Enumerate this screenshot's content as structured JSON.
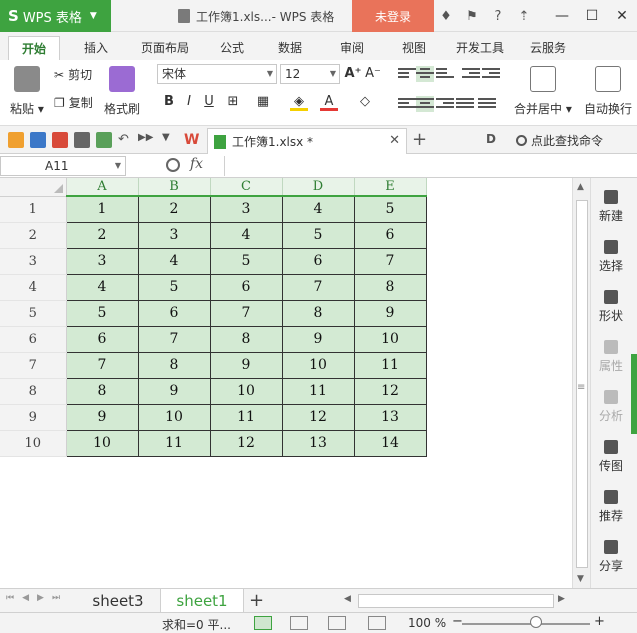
{
  "app": {
    "name": "WPS 表格",
    "doc_title": "工作簿1.xls...- WPS 表格",
    "login_label": "未登录"
  },
  "menu": {
    "tabs": [
      "开始",
      "插入",
      "页面布局",
      "公式",
      "数据",
      "审阅",
      "视图",
      "开发工具",
      "云服务"
    ],
    "active_index": 0
  },
  "ribbon": {
    "paste": "粘贴",
    "cut": "剪切",
    "copy": "复制",
    "format_painter": "格式刷",
    "font_name": "宋体",
    "font_size": "12",
    "bold": "B",
    "italic": "I",
    "underline": "U",
    "merge_center": "合并居中",
    "auto_wrap": "自动换行"
  },
  "doc_tab": {
    "label": "工作簿1.xlsx *",
    "search_cmd": "点此查找命令"
  },
  "formula_bar": {
    "name_box": "A11",
    "fx": "fx",
    "content": ""
  },
  "sheet": {
    "columns": [
      "A",
      "B",
      "C",
      "D",
      "E"
    ],
    "rows": [
      {
        "header": "1",
        "cells": [
          "1",
          "2",
          "3",
          "4",
          "5"
        ]
      },
      {
        "header": "2",
        "cells": [
          "2",
          "3",
          "4",
          "5",
          "6"
        ]
      },
      {
        "header": "3",
        "cells": [
          "3",
          "4",
          "5",
          "6",
          "7"
        ]
      },
      {
        "header": "4",
        "cells": [
          "4",
          "5",
          "6",
          "7",
          "8"
        ]
      },
      {
        "header": "5",
        "cells": [
          "5",
          "6",
          "7",
          "8",
          "9"
        ]
      },
      {
        "header": "6",
        "cells": [
          "6",
          "7",
          "8",
          "9",
          "10"
        ]
      },
      {
        "header": "7",
        "cells": [
          "7",
          "8",
          "9",
          "10",
          "11"
        ]
      },
      {
        "header": "8",
        "cells": [
          "8",
          "9",
          "10",
          "11",
          "12"
        ]
      },
      {
        "header": "9",
        "cells": [
          "9",
          "10",
          "11",
          "12",
          "13"
        ]
      },
      {
        "header": "10",
        "cells": [
          "10",
          "11",
          "12",
          "13",
          "14"
        ]
      }
    ]
  },
  "side_panel": {
    "items": [
      "新建",
      "选择",
      "形状",
      "属性",
      "分析",
      "传图",
      "推荐",
      "分享"
    ],
    "disabled": [
      false,
      false,
      false,
      true,
      true,
      false,
      false,
      false
    ]
  },
  "sheet_tabs": {
    "tabs": [
      "sheet3",
      "sheet1"
    ],
    "active_index": 1
  },
  "status_bar": {
    "summary": "求和=0  平...",
    "zoom": "100 %"
  },
  "colors": {
    "brand_green": "#3ea340",
    "login_orange": "#e9735a",
    "cell_fill": "#d3ead3"
  }
}
